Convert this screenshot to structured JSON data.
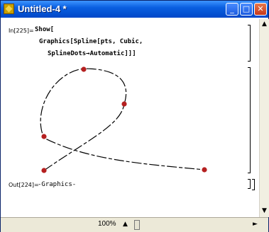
{
  "window": {
    "title": "Untitled-4 *"
  },
  "titlebar_buttons": {
    "minimize": "_",
    "maximize": "□",
    "close": "✕"
  },
  "cell_input": {
    "label": "In[225]=",
    "line1": "Show[",
    "line2": "Graphics[Spline[pts, Cubic,",
    "line3": "SplineDots→Automatic]]]"
  },
  "cell_output": {
    "label": "Out[224]=",
    "value": "-Graphics-"
  },
  "status_bar": {
    "zoom": "100%"
  },
  "icons": [
    "mathematica-app-icon",
    "minimize-icon",
    "maximize-icon",
    "close-icon",
    "scroll-up-icon",
    "scroll-down-icon",
    "scroll-left-icon",
    "scroll-right-icon"
  ],
  "colors": {
    "titlebar": "#0a5fe0",
    "dot": "#b52020",
    "curve": "#000000"
  }
}
